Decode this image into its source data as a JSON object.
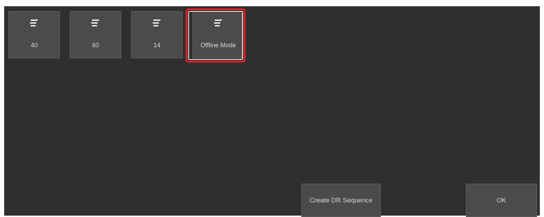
{
  "profiles": [
    {
      "label": "40",
      "icon": "profile-icon"
    },
    {
      "label": "60",
      "icon": "profile-icon"
    },
    {
      "label": "14",
      "icon": "profile-icon"
    },
    {
      "label": "Offline Mode",
      "icon": "profile-icon",
      "selected": true
    }
  ],
  "actions": {
    "create_dr_sequence_label": "Create DR Sequence",
    "ok_label": "OK"
  },
  "colors": {
    "background": "#2f2f2f",
    "tile": "#4b4b4b",
    "text": "#d8d8d8",
    "highlight": "#d0232a"
  }
}
